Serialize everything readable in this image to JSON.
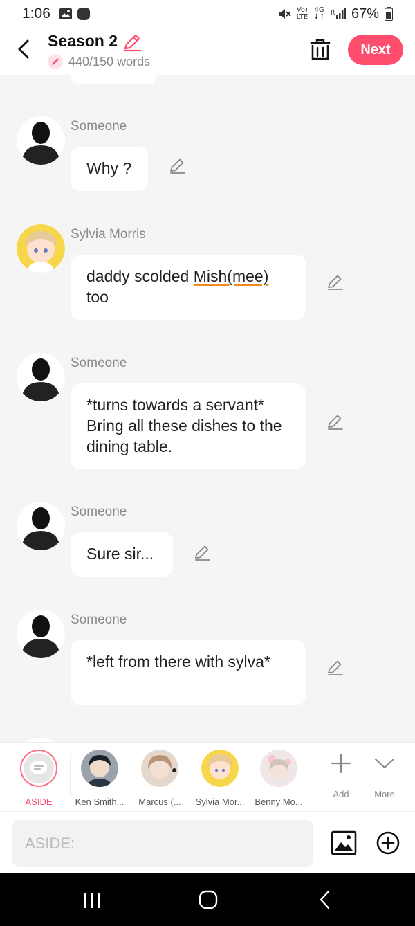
{
  "status": {
    "time": "1:06",
    "battery": "67%",
    "net_top": "Vo)",
    "net_bottom": "LTE",
    "net2_top": "4G",
    "net2_bottom": "↓↑",
    "signal": "R"
  },
  "header": {
    "title": "Season 2",
    "word_count": "440/150 words",
    "next_label": "Next"
  },
  "messages": [
    {
      "sender": "Someone",
      "text": "Why ?"
    },
    {
      "sender": "Sylvia Morris",
      "text_before": "daddy scolded ",
      "underlined_1": "Mish",
      "underlined_2": "(mee)",
      "text_after": "too"
    },
    {
      "sender": "Someone",
      "text": "*turns towards a servant* Bring all these dishes to the dining table."
    },
    {
      "sender": "Someone",
      "text": "Sure sir..."
    },
    {
      "sender": "Someone",
      "text": "*left from there with sylva*"
    }
  ],
  "characters": [
    {
      "name": "ASIDE"
    },
    {
      "name": "Ken Smith..."
    },
    {
      "name": "Marcus (..."
    },
    {
      "name": "Sylvia Mor..."
    },
    {
      "name": "Benny Mo..."
    }
  ],
  "tools": {
    "add": "Add",
    "more": "More"
  },
  "input": {
    "placeholder": "ASIDE:"
  },
  "colors": {
    "accent": "#ff4d6d",
    "underline": "#f08a1c",
    "background": "#f5f5f5"
  }
}
